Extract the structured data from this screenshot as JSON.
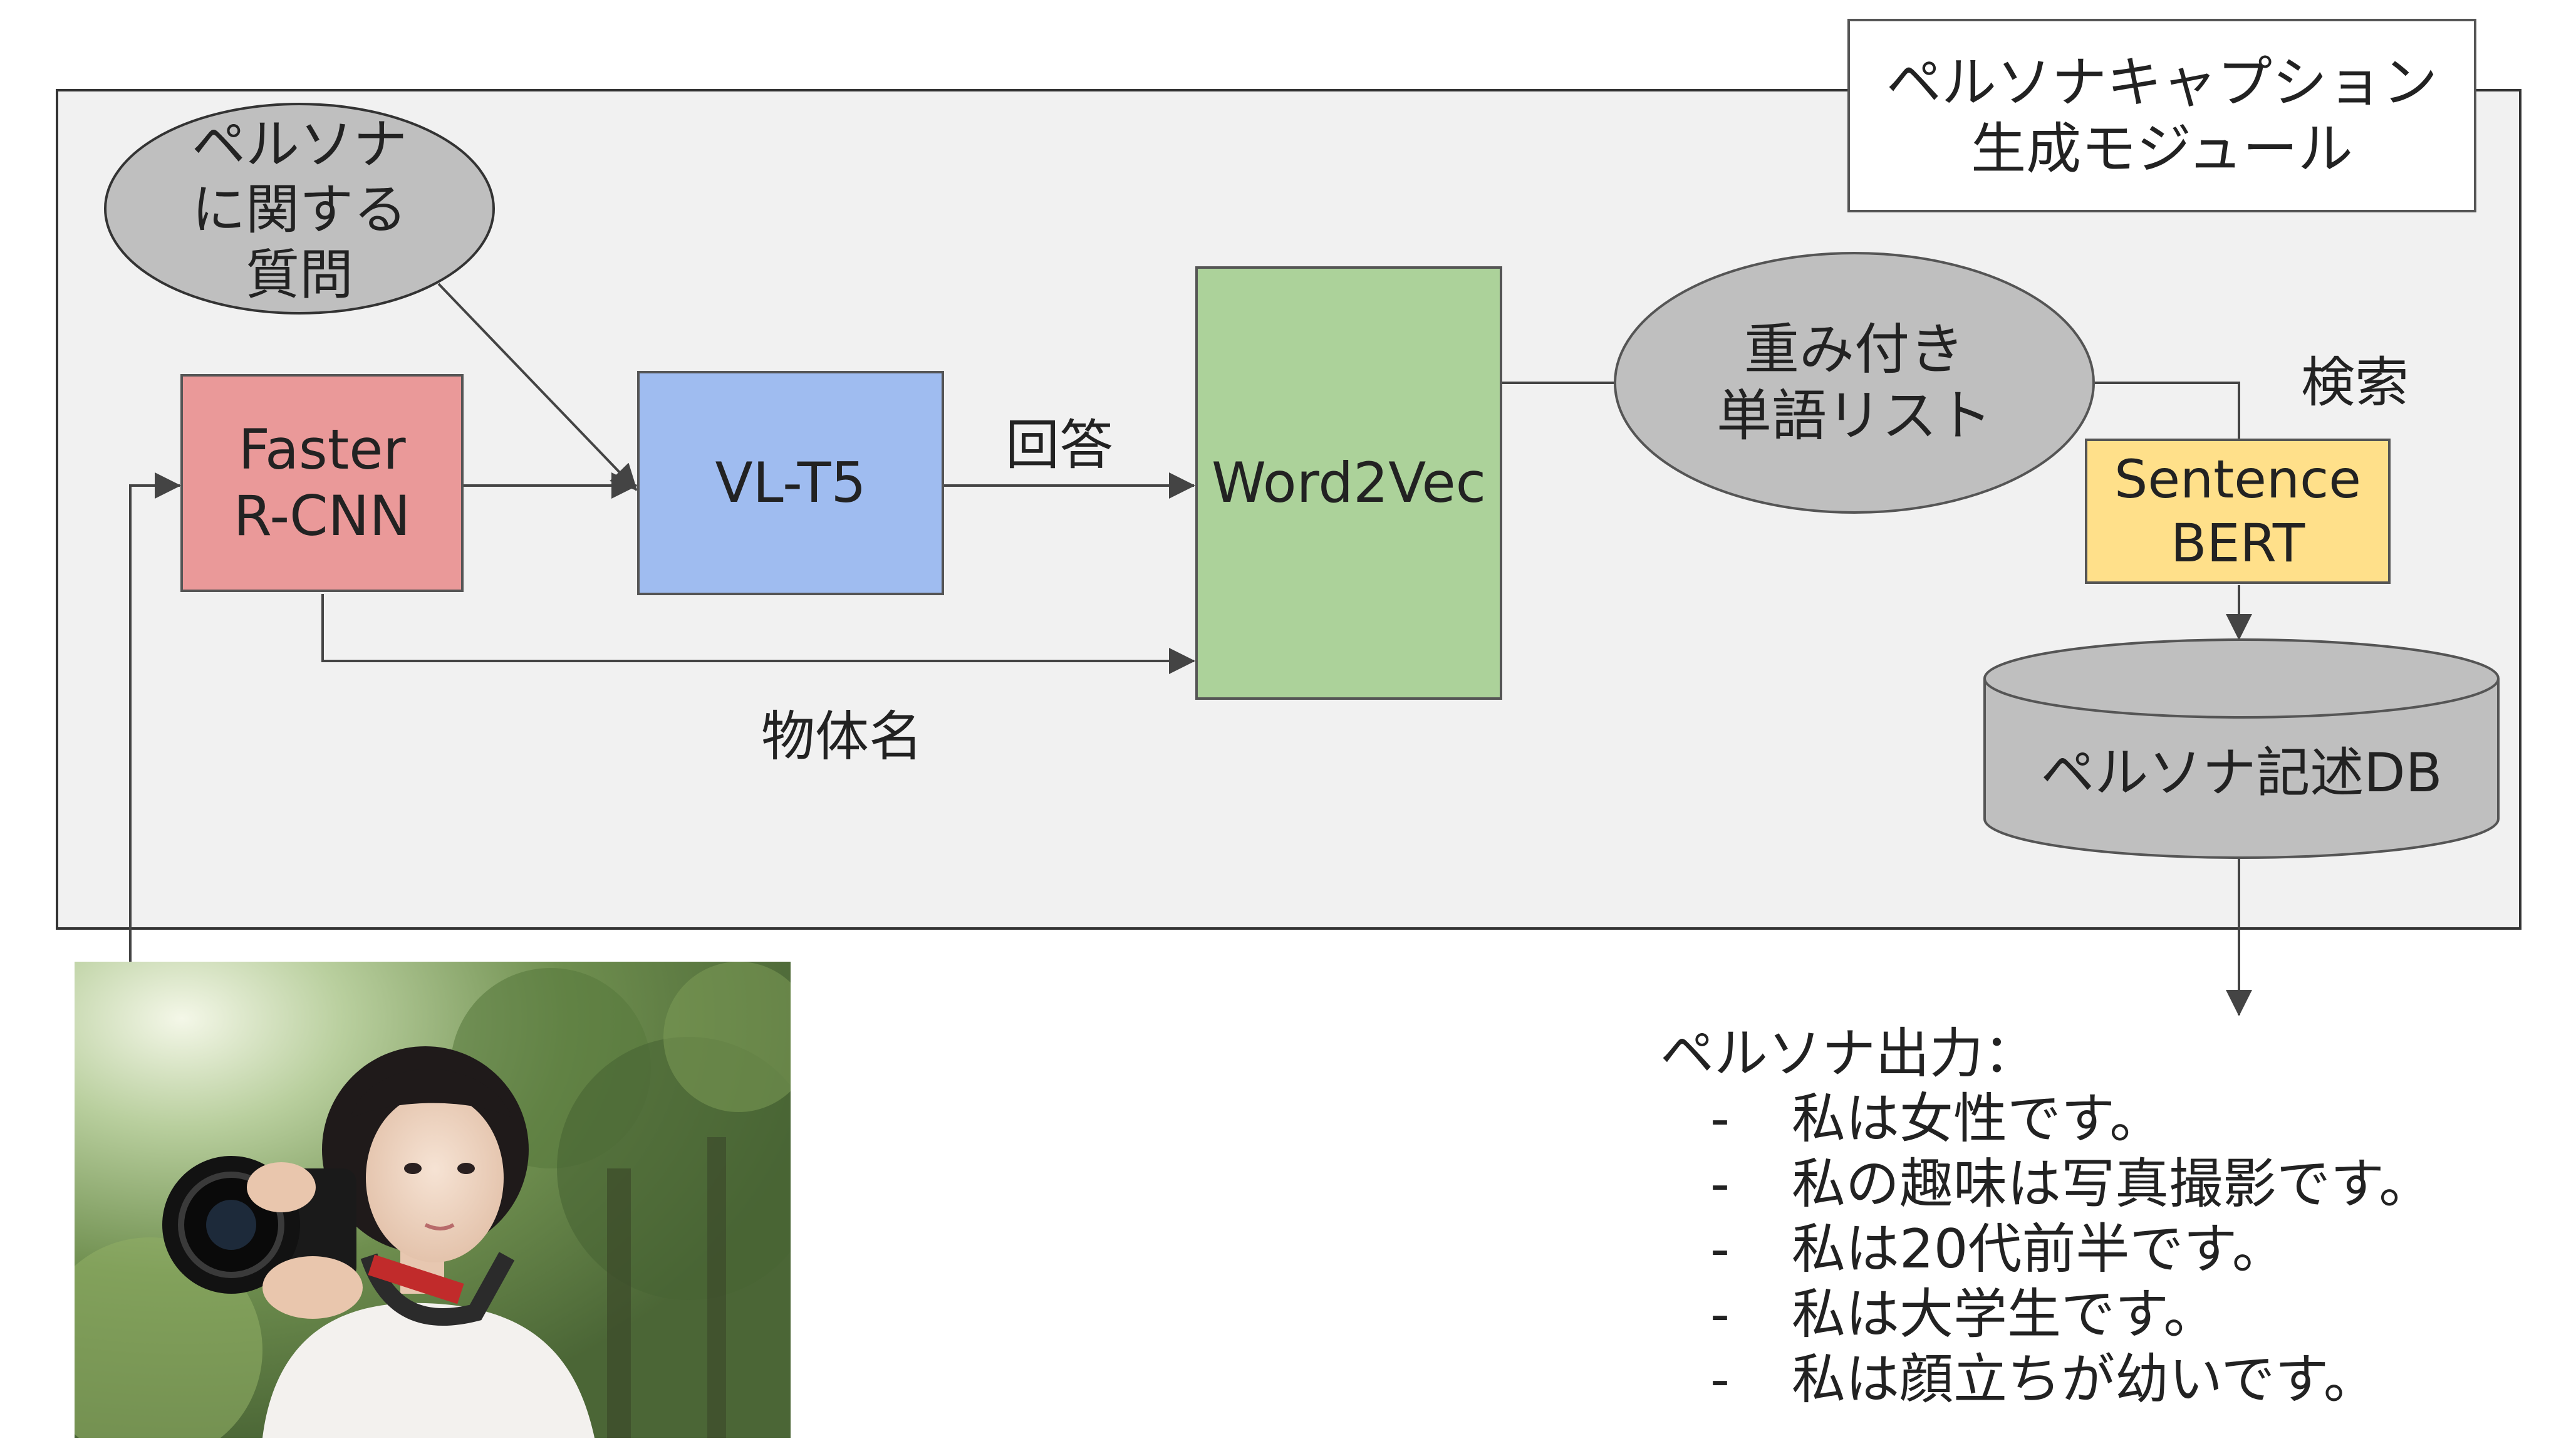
{
  "module": {
    "title_line1": "ペルソナキャプション",
    "title_line2": "生成モジュール"
  },
  "nodes": {
    "question": {
      "line1": "ペルソナ",
      "line2": "に関する",
      "line3": "質問"
    },
    "faster_rcnn": {
      "line1": "Faster",
      "line2": "R-CNN"
    },
    "vlt5": {
      "label": "VL-T5"
    },
    "word2vec": {
      "label": "Word2Vec"
    },
    "weighted_words": {
      "line1": "重み付き",
      "line2": "単語リスト"
    },
    "sentence_bert": {
      "line1": "Sentence",
      "line2": "BERT"
    },
    "persona_db": {
      "label": "ペルソナ記述DB"
    }
  },
  "edges": {
    "answer_label": "回答",
    "object_name_label": "物体名",
    "search_label": "検索"
  },
  "output": {
    "heading": "ペルソナ出力：",
    "dash": "-",
    "items": [
      "私は女性です。",
      "私の趣味は写真撮影です。",
      "私は20代前半です。",
      "私は大学生です。",
      "私は顔立ちが幼いです。"
    ]
  },
  "colors": {
    "faster_rcnn": "#ea9999",
    "vlt5": "#9fbcf0",
    "word2vec": "#acd29a",
    "sentence_bert": "#ffe08a",
    "gray_node": "#bfbfbf",
    "module_bg": "#f1f1f1"
  }
}
